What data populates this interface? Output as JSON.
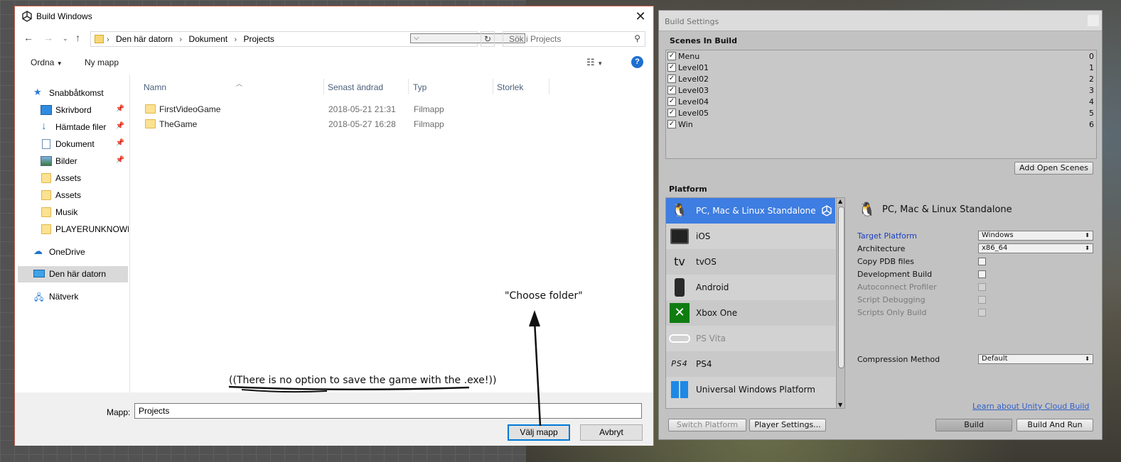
{
  "file_dialog": {
    "title": "Build Windows",
    "breadcrumbs": [
      "Den här datorn",
      "Dokument",
      "Projects"
    ],
    "search_placeholder": "Sök i Projects",
    "toolbar": {
      "organize": "Ordna",
      "new_folder": "Ny mapp"
    },
    "sidebar": [
      {
        "label": "Snabbåtkomst",
        "icon": "star-icon"
      },
      {
        "label": "Skrivbord",
        "icon": "desktop-icon",
        "pinned": true
      },
      {
        "label": "Hämtade filer",
        "icon": "download-icon",
        "pinned": true
      },
      {
        "label": "Dokument",
        "icon": "document-icon",
        "pinned": true
      },
      {
        "label": "Bilder",
        "icon": "pictures-icon",
        "pinned": true
      },
      {
        "label": "Assets",
        "icon": "folder-icon"
      },
      {
        "label": "Assets",
        "icon": "folder-icon"
      },
      {
        "label": "Musik",
        "icon": "folder-icon"
      },
      {
        "label": "PLAYERUNKNOWN",
        "icon": "folder-icon"
      },
      {
        "label": "OneDrive",
        "icon": "cloud-icon"
      },
      {
        "label": "Den här datorn",
        "icon": "computer-icon",
        "selected": true
      },
      {
        "label": "Nätverk",
        "icon": "network-icon"
      }
    ],
    "columns": [
      "Namn",
      "Senast ändrad",
      "Typ",
      "Storlek"
    ],
    "files": [
      {
        "name": "FirstVideoGame",
        "modified": "2018-05-21 21:31",
        "type": "Filmapp"
      },
      {
        "name": "TheGame",
        "modified": "2018-05-27 16:28",
        "type": "Filmapp"
      }
    ],
    "folder_label": "Mapp:",
    "folder_value": "Projects",
    "choose_button": "Välj mapp",
    "cancel_button": "Avbryt"
  },
  "annotations": {
    "choose_folder": "\"Choose folder\"",
    "no_exe": "((There is no option to save the game with the .exe!))"
  },
  "build_settings": {
    "title": "Build Settings",
    "scenes_header": "Scenes In Build",
    "scenes": [
      {
        "name": "Menu",
        "index": "0",
        "checked": true
      },
      {
        "name": "Level01",
        "index": "1",
        "checked": true
      },
      {
        "name": "Level02",
        "index": "2",
        "checked": true
      },
      {
        "name": "Level03",
        "index": "3",
        "checked": true
      },
      {
        "name": "Level04",
        "index": "4",
        "checked": true
      },
      {
        "name": "Level05",
        "index": "5",
        "checked": true
      },
      {
        "name": "Win",
        "index": "6",
        "checked": true
      }
    ],
    "add_open_scenes": "Add Open Scenes",
    "platform_header": "Platform",
    "platforms": [
      {
        "name": "PC, Mac & Linux Standalone",
        "icon": "tux-icon",
        "selected": true
      },
      {
        "name": "iOS",
        "icon": "ipad-icon"
      },
      {
        "name": "tvOS",
        "icon": "appletv-icon"
      },
      {
        "name": "Android",
        "icon": "android-phone-icon"
      },
      {
        "name": "Xbox One",
        "icon": "xbox-icon"
      },
      {
        "name": "PS Vita",
        "icon": "psvita-icon"
      },
      {
        "name": "PS4",
        "icon": "ps4-icon"
      },
      {
        "name": "Universal Windows Platform",
        "icon": "windows-icon"
      }
    ],
    "selected_platform": "PC, Mac & Linux Standalone",
    "settings": {
      "target_platform_label": "Target Platform",
      "target_platform_value": "Windows",
      "architecture_label": "Architecture",
      "architecture_value": "x86_64",
      "copy_pdb_label": "Copy PDB files",
      "development_build_label": "Development Build",
      "autoconnect_label": "Autoconnect Profiler",
      "script_debugging_label": "Script Debugging",
      "scripts_only_label": "Scripts Only Build",
      "compression_label": "Compression Method",
      "compression_value": "Default"
    },
    "cloud_link": "Learn about Unity Cloud Build",
    "buttons": {
      "switch_platform": "Switch Platform",
      "player_settings": "Player Settings...",
      "build": "Build",
      "build_and_run": "Build And Run"
    }
  }
}
